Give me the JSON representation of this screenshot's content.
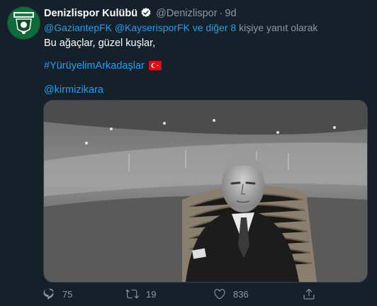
{
  "tweet": {
    "author_name": "Denizlispor Kulübü",
    "handle": "@Denizlispor",
    "separator": "·",
    "time": "9d",
    "reply": {
      "mention1": "@GaziantepFK",
      "mention2": "@KayserisporFK",
      "others_link": "ve diğer 8",
      "suffix": "kişiye yanıt olarak"
    },
    "text_line1": "Bu ağaçlar, güzel kuşlar,",
    "hashtag": "#YürüyelimArkadaşlar",
    "mention_line": "@kirmizikara"
  },
  "actions": {
    "reply_count": "75",
    "retweet_count": "19",
    "like_count": "836"
  },
  "colors": {
    "background": "#15202b",
    "link": "#1da1f2",
    "muted": "#8899a6",
    "verified": "#ffffff"
  },
  "icons": [
    "verified-badge-icon",
    "turkish-flag-icon",
    "reply-icon",
    "retweet-icon",
    "like-icon",
    "share-icon"
  ]
}
